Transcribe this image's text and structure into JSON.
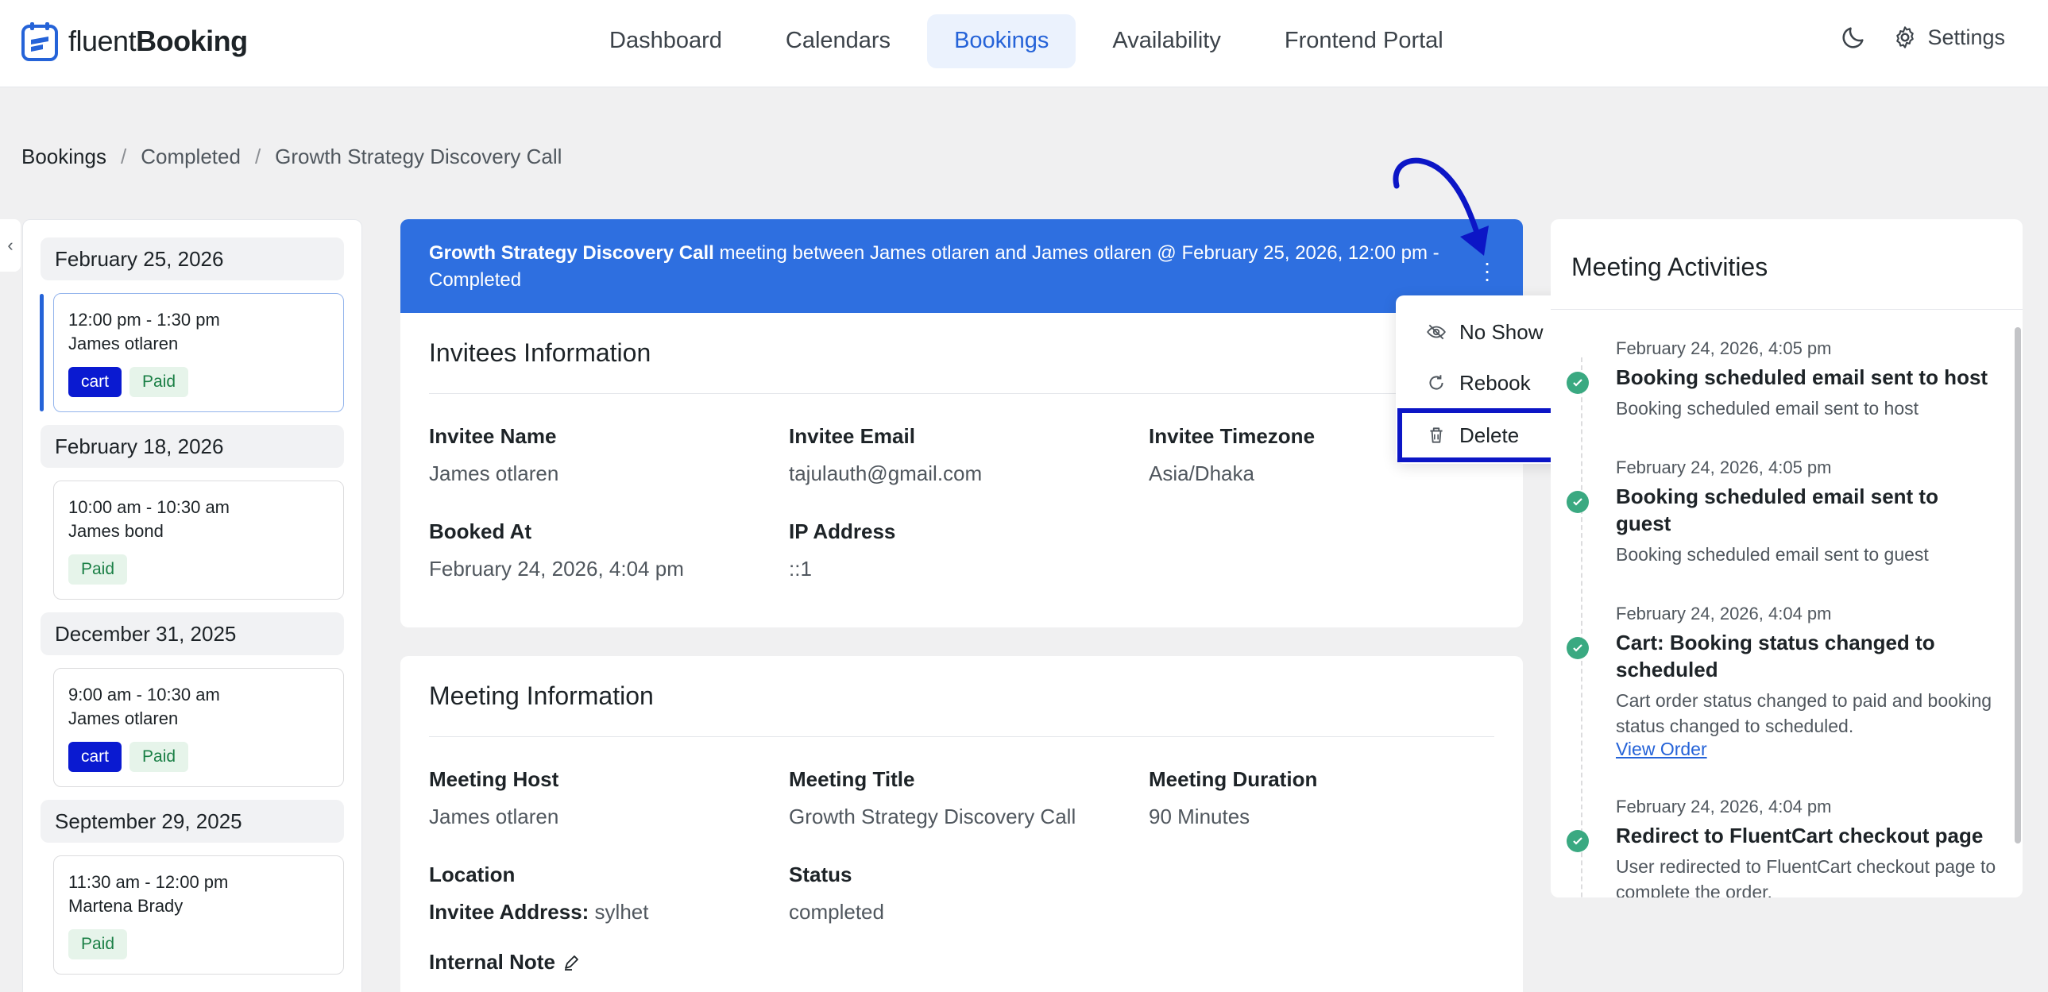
{
  "app": {
    "logo_light": "fluent",
    "logo_bold": "Booking"
  },
  "nav": {
    "items": [
      "Dashboard",
      "Calendars",
      "Bookings",
      "Availability",
      "Frontend Portal"
    ],
    "active": "Bookings"
  },
  "topright": {
    "settings_label": "Settings"
  },
  "breadcrumb": {
    "items": [
      "Bookings",
      "Completed",
      "Growth Strategy Discovery Call"
    ]
  },
  "bookings": [
    {
      "date": "February 25, 2026",
      "time": "12:00 pm - 1:30 pm",
      "name": "James otlaren",
      "tags": [
        "cart",
        "Paid"
      ]
    },
    {
      "date": "February 18, 2026",
      "time": "10:00 am - 10:30 am",
      "name": "James bond",
      "tags": [
        "Paid"
      ]
    },
    {
      "date": "December 31, 2025",
      "time": "9:00 am - 10:30 am",
      "name": "James otlaren",
      "tags": [
        "cart",
        "Paid"
      ]
    },
    {
      "date": "September 29, 2025",
      "time": "11:30 am - 12:00 pm",
      "name": "Martena Brady",
      "tags": [
        "Paid"
      ]
    }
  ],
  "banner": {
    "title": "Growth Strategy Discovery Call",
    "text": " meeting between James otlaren and James otlaren @ February 25, 2026, 12:00 pm - Completed"
  },
  "dropdown": {
    "items": [
      "No Show",
      "Rebook",
      "Delete"
    ]
  },
  "invitees": {
    "title": "Invitees Information",
    "name_label": "Invitee Name",
    "name": "James otlaren",
    "email_label": "Invitee Email",
    "email": "tajulauth@gmail.com",
    "tz_label": "Invitee Timezone",
    "tz": "Asia/Dhaka",
    "booked_label": "Booked At",
    "booked": "February 24, 2026, 4:04 pm",
    "ip_label": "IP Address",
    "ip": "::1"
  },
  "meeting": {
    "title": "Meeting Information",
    "host_label": "Meeting Host",
    "host": "James otlaren",
    "mtitle_label": "Meeting Title",
    "mtitle": "Growth Strategy Discovery Call",
    "duration_label": "Meeting Duration",
    "duration": "90 Minutes",
    "location_label": "Location",
    "location_prefix": "Invitee Address:",
    "location_value": " sylhet",
    "status_label": "Status",
    "status": "completed",
    "note_label": "Internal Note"
  },
  "activities": {
    "title": "Meeting Activities",
    "items": [
      {
        "time": "February 24, 2026, 4:05 pm",
        "title": "Booking scheduled email sent to host",
        "desc": "Booking scheduled email sent to host"
      },
      {
        "time": "February 24, 2026, 4:05 pm",
        "title": "Booking scheduled email sent to guest",
        "desc": "Booking scheduled email sent to guest"
      },
      {
        "time": "February 24, 2026, 4:04 pm",
        "title": "Cart: Booking status changed to scheduled",
        "desc": "Cart order status changed to paid and booking status changed to scheduled.",
        "link": "View Order"
      },
      {
        "time": "February 24, 2026, 4:04 pm",
        "title": "Redirect to FluentCart checkout page",
        "desc": "User redirected to FluentCart checkout page to complete the order."
      }
    ]
  },
  "colors": {
    "primary": "#2e6fe0",
    "annotation": "#0c16c6",
    "success": "#3aa981"
  }
}
